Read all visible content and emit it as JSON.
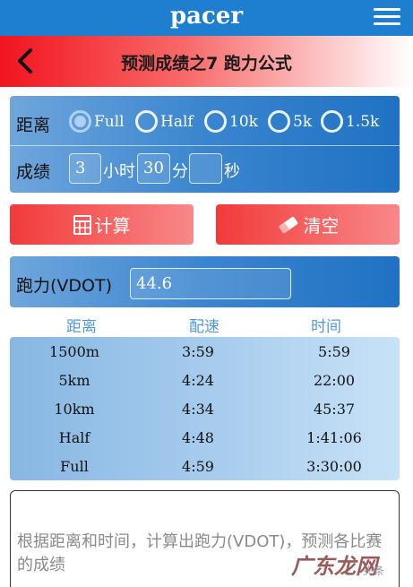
{
  "header": {
    "logo": "pacer",
    "menu_icon": "hamburger-menu-icon"
  },
  "titlebar": {
    "title": "预测成绩之7 跑力公式",
    "back_icon": "chevron-left-icon"
  },
  "form": {
    "distance_label": "距离",
    "distance_options": [
      "Full",
      "Half",
      "10k",
      "5k",
      "1.5k"
    ],
    "selected_distance": "Full",
    "result_label": "成绩",
    "hours": "3",
    "hours_unit": "小时",
    "minutes": "30",
    "minutes_unit": "分",
    "seconds": "",
    "seconds_unit": "秒"
  },
  "actions": {
    "calc_label": "计算",
    "calc_icon": "calculator-icon",
    "clear_label": "清空",
    "clear_icon": "eraser-icon"
  },
  "vdot": {
    "label": "跑力(VDOT)",
    "value": "44.6"
  },
  "table": {
    "headers": [
      "距离",
      "配速",
      "时间"
    ],
    "rows": [
      [
        "1500m",
        "3:59",
        "5:59"
      ],
      [
        "5km",
        "4:24",
        "22:00"
      ],
      [
        "10km",
        "4:34",
        "45:37"
      ],
      [
        "Half",
        "4:48",
        "1:41:06"
      ],
      [
        "Full",
        "4:59",
        "3:30:00"
      ]
    ]
  },
  "description": "根据距离和时间，计算出跑力(VDOT)，预测各比赛的成绩",
  "watermark": {
    "text": "广东龙网",
    "sub": "头条"
  },
  "colors": {
    "header_blue": "#1e7fd0",
    "title_red": "#f2141e",
    "panel_blue": "#1f72c3",
    "button_red": "#f23a3a"
  }
}
